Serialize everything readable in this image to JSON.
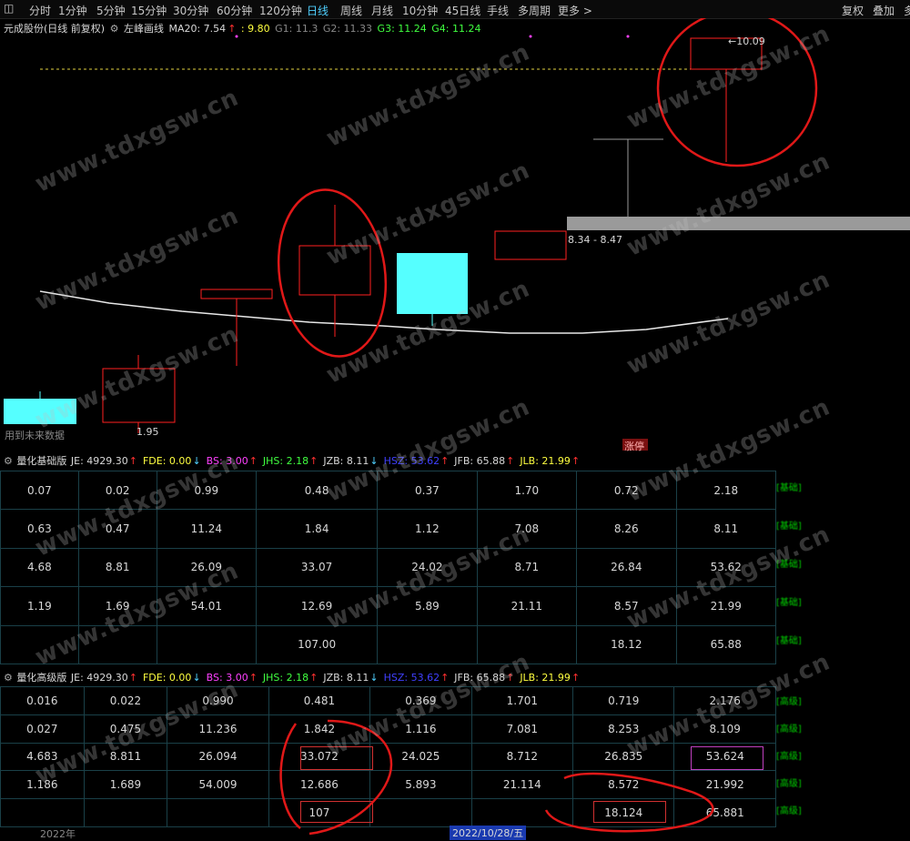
{
  "toolbar": {
    "items": [
      "分时",
      "1分钟",
      "5分钟",
      "15分钟",
      "30分钟",
      "60分钟",
      "120分钟",
      "日线",
      "周线",
      "月线",
      "10分钟",
      "45日线",
      "手线",
      "多周期",
      "更多 >"
    ],
    "active": "日线",
    "right_items": [
      "复权",
      "叠加",
      "多"
    ]
  },
  "info": {
    "title": "元成股份(日线 前复权)",
    "indicator": "左峰画线",
    "ma20": "MA20: 7.54",
    "v1": ": 9.80",
    "g1": "G1: 11.3",
    "g2": "G2: 11.33",
    "g3": "G3: 11.24",
    "g4": "G4: 11.24"
  },
  "chart": {
    "high_label": "10.09",
    "range_label": "8.34 - 8.47",
    "future_label": "用到未来数据",
    "small_label": "1.95",
    "tag_label": "涨停",
    "colors": {
      "up": "#ff2020",
      "down": "#55ffff",
      "ma": "#e8e8e8",
      "dash": "#e0d040",
      "band": "#9a9a9a",
      "annotation": "#e01818"
    }
  },
  "panel1": {
    "title": "量化基础版",
    "vals": [
      {
        "k": "JE: 4929.30",
        "c": "#d8d8d8",
        "arrow": "up"
      },
      {
        "k": "FDE: 0.00",
        "c": "#ffff40",
        "arrow": "down"
      },
      {
        "k": "BS: 3.00",
        "c": "#ff40ff",
        "arrow": "up"
      },
      {
        "k": "JHS: 2.18",
        "c": "#40ff40",
        "arrow": "up"
      },
      {
        "k": "JZB: 8.11",
        "c": "#d8d8d8",
        "arrow": "down"
      },
      {
        "k": "HSZ: 53.62",
        "c": "#4040ff",
        "arrow": "up"
      },
      {
        "k": "JFB: 65.88",
        "c": "#d8d8d8",
        "arrow": "up"
      },
      {
        "k": "JLB: 21.99",
        "c": "#ffff40",
        "arrow": "up"
      }
    ],
    "rows": [
      [
        "0.07",
        "0.02",
        "0.99",
        "0.48",
        "0.37",
        "1.70",
        "0.72",
        "2.18"
      ],
      [
        "0.63",
        "0.47",
        "11.24",
        "1.84",
        "1.12",
        "7.08",
        "8.26",
        "8.11"
      ],
      [
        "4.68",
        "8.81",
        "26.09",
        "33.07",
        "24.02",
        "8.71",
        "26.84",
        "53.62"
      ],
      [
        "1.19",
        "1.69",
        "54.01",
        "12.69",
        "5.89",
        "21.11",
        "8.57",
        "21.99"
      ],
      [
        "",
        "",
        "",
        "107.00",
        "",
        "",
        "18.12",
        "65.88"
      ]
    ],
    "side": [
      "[基础]",
      "[基础]",
      "[基础]",
      "[基础]",
      "[基础]"
    ]
  },
  "panel2": {
    "title": "量化高级版",
    "vals": [
      {
        "k": "JE: 4929.30",
        "c": "#d8d8d8",
        "arrow": "up"
      },
      {
        "k": "FDE: 0.00",
        "c": "#ffff40",
        "arrow": "down"
      },
      {
        "k": "BS: 3.00",
        "c": "#ff40ff",
        "arrow": "up"
      },
      {
        "k": "JHS: 2.18",
        "c": "#40ff40",
        "arrow": "up"
      },
      {
        "k": "JZB: 8.11",
        "c": "#d8d8d8",
        "arrow": "down"
      },
      {
        "k": "HSZ: 53.62",
        "c": "#4040ff",
        "arrow": "up"
      },
      {
        "k": "JFB: 65.88",
        "c": "#d8d8d8",
        "arrow": "up"
      },
      {
        "k": "JLB: 21.99",
        "c": "#ffff40",
        "arrow": "up"
      }
    ],
    "rows": [
      [
        "0.016",
        "0.022",
        "0.990",
        "0.481",
        "0.369",
        "1.701",
        "0.719",
        "2.176"
      ],
      [
        "0.027",
        "0.475",
        "11.236",
        "1.842",
        "1.116",
        "7.081",
        "8.253",
        "8.109"
      ],
      [
        "4.683",
        "8.811",
        "26.094",
        "33.072",
        "24.025",
        "8.712",
        "26.835",
        "53.624"
      ],
      [
        "1.186",
        "1.689",
        "54.009",
        "12.686",
        "5.893",
        "21.114",
        "8.572",
        "21.992"
      ],
      [
        "",
        "",
        "",
        "107",
        "",
        "",
        "18.124",
        "65.881"
      ]
    ],
    "side": [
      "[高级]",
      "[高级]",
      "[高级]",
      "[高级]",
      "[高级]"
    ]
  },
  "footer": {
    "left": "2022年",
    "date": "2022/10/28/五"
  },
  "watermark": "www.tdxgsw.cn"
}
